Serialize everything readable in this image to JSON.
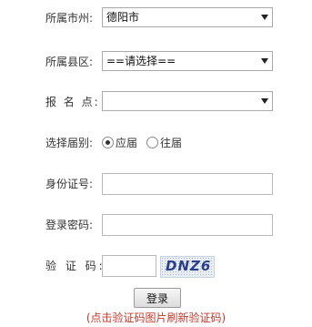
{
  "form": {
    "city": {
      "label": "所属市州:",
      "value": "德阳市"
    },
    "county": {
      "label": "所属县区:",
      "value": "==请选择=="
    },
    "site": {
      "label": "报 名 点:",
      "value": ""
    },
    "session": {
      "label": "选择届别:",
      "options": [
        "应届",
        "往届"
      ],
      "selected": "应届"
    },
    "id_number": {
      "label": "身份证号:",
      "value": ""
    },
    "password": {
      "label": "登录密码:",
      "value": ""
    },
    "captcha": {
      "label": "验 证 码:",
      "value": "",
      "code": "DNZ6"
    }
  },
  "login_button": "登录",
  "hint": "(点击验证码图片刷新验证码)"
}
